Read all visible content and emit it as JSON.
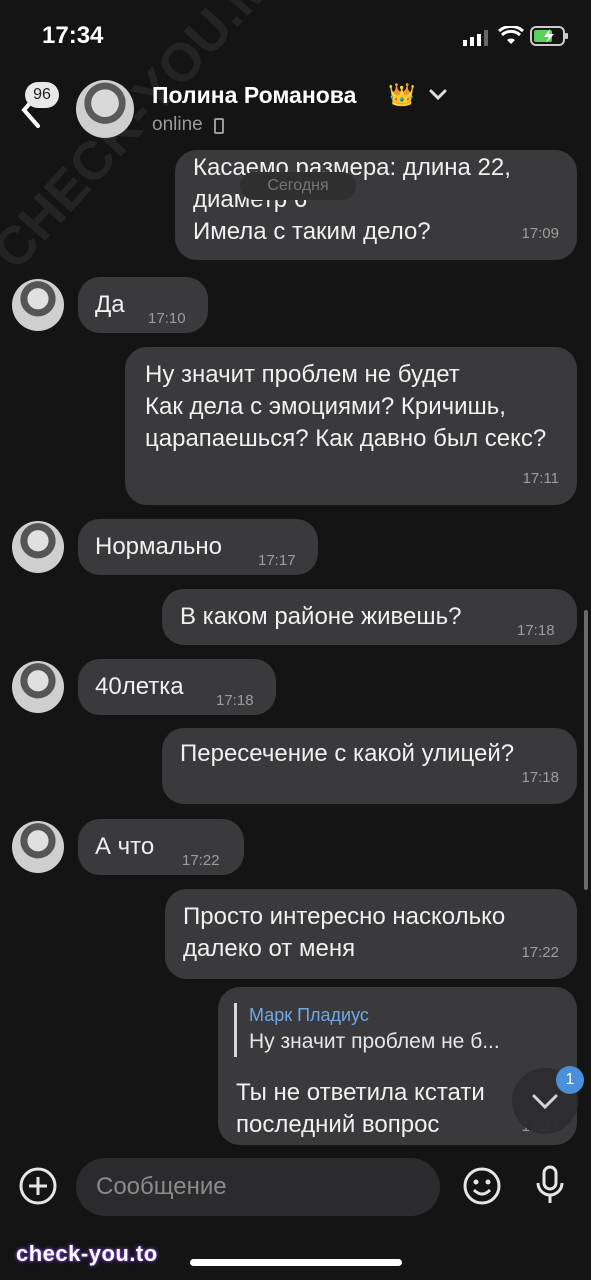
{
  "status_bar": {
    "time": "17:34"
  },
  "header": {
    "back_badge": "96",
    "name": "Полина Романова",
    "crown": "👑",
    "status": "online"
  },
  "date_pill": "Сегодня",
  "messages": [
    {
      "text": "Касаемо размера: длина 22, диаметр 6\nИмела с таким дело?",
      "time": "17:09",
      "side": "out"
    },
    {
      "text": "Да",
      "time": "17:10",
      "side": "in"
    },
    {
      "text": "Ну значит проблем не будет\nКак дела с эмоциями? Кричишь, царапаешься? Как давно был секс?",
      "time": "17:11",
      "side": "out"
    },
    {
      "text": "Нормально",
      "time": "17:17",
      "side": "in"
    },
    {
      "text": "В каком районе живешь?",
      "time": "17:18",
      "side": "out"
    },
    {
      "text": "40летка",
      "time": "17:18",
      "side": "in"
    },
    {
      "text": "Пересечение с какой улицей?",
      "time": "17:18",
      "side": "out"
    },
    {
      "text": "А что",
      "time": "17:22",
      "side": "in"
    },
    {
      "text": "Просто интересно насколько далеко от меня",
      "time": "17:22",
      "side": "out"
    },
    {
      "reply_author": "Марк Пладиус",
      "reply_text": "Ну значит проблем не б...",
      "text": "Ты не ответила кстати последний вопрос",
      "time": "17:23",
      "side": "out"
    }
  ],
  "scroll_badge": "1",
  "composer": {
    "placeholder": "Сообщение"
  },
  "watermark": {
    "bottom": "check-you.to",
    "diagonal": "CHECK-YOU.ME"
  }
}
